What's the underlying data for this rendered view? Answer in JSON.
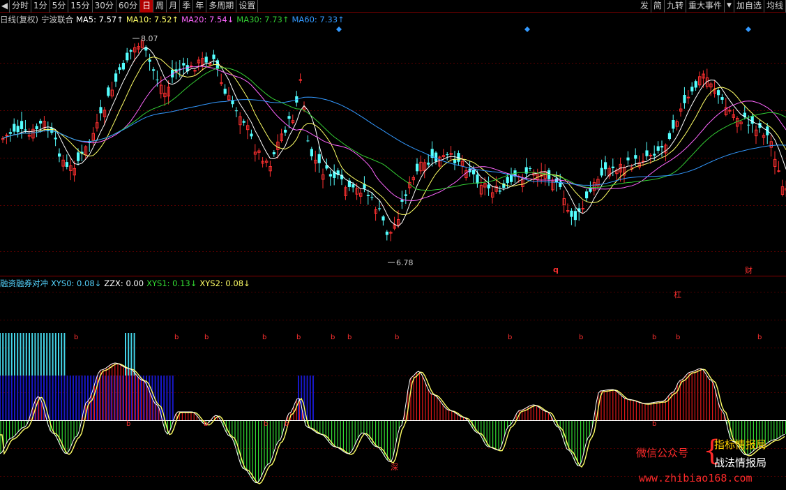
{
  "toolbar": {
    "back_icon": "◀",
    "left": [
      "分时",
      "1分",
      "5分",
      "15分",
      "30分",
      "60分",
      "日",
      "周",
      "月",
      "季",
      "年",
      "多周期",
      "设置"
    ],
    "active": "日",
    "right": [
      "发",
      "简",
      "九转",
      "重大事件"
    ],
    "dropdown_icon": "▼",
    "right2": [
      "加自选",
      "均线"
    ]
  },
  "ma_legend": {
    "period": "日线(复权)",
    "stock_name": "宁波联合",
    "ma5": "MA5: 7.57↑",
    "ma10": "MA10: 7.52↑",
    "ma20": "MA20: 7.54↓",
    "ma30": "MA30: 7.73↑",
    "ma60": "MA60: 7.33↑"
  },
  "price_labels": {
    "high": "8.07",
    "low": "6.78"
  },
  "price_markers": {
    "q": "q",
    "cai": "财"
  },
  "sub_legend": {
    "name": "融资融券对冲",
    "xys0": "XYS0: 0.08↓",
    "zzx": "ZZX: 0.00",
    "xys1": "XYS1: 0.13↓",
    "xys2": "XYS2: 0.08↓"
  },
  "signals": {
    "gang": "杠",
    "b": "b",
    "shen": "深"
  },
  "colors": {
    "up": "#ff3030",
    "down": "#54ffff",
    "ma5": "#ffffff",
    "ma10": "#ffff66",
    "ma20": "#ff66ff",
    "ma30": "#33cc33",
    "ma60": "#3399ff",
    "pos_bar": "#e01818",
    "neg_bar": "#33dd33",
    "cyan_bar": "#44d4e8",
    "blue_bar": "#1818c8"
  },
  "watermark": {
    "wechat": "微信公众号",
    "brace": "{",
    "line1": "指标情报局",
    "line2": "战法情报局",
    "url": "www.zhibiao168.com"
  }
}
